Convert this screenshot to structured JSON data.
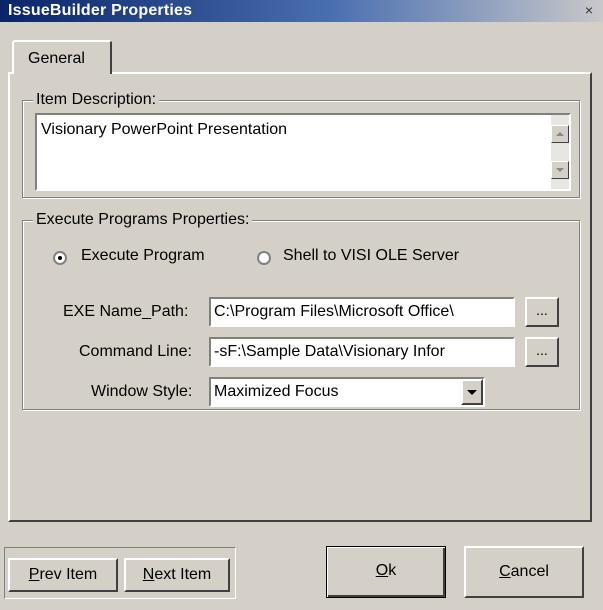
{
  "window": {
    "title": "IssueBuilder Properties",
    "close_glyph": "×"
  },
  "tabs": [
    {
      "label": "General",
      "selected": true
    }
  ],
  "item_description": {
    "legend": "Item Description:",
    "value": "Visionary PowerPoint Presentation"
  },
  "execute": {
    "legend": "Execute Programs Properties:",
    "radio_execute": {
      "label": "Execute Program",
      "checked": true
    },
    "radio_shell": {
      "label": "Shell to VISI OLE Server",
      "checked": false
    },
    "exe_label": "EXE Name_Path:",
    "exe_value": "C:\\Program Files\\Microsoft Office\\",
    "cmd_label": "Command Line:",
    "cmd_value": "-sF:\\Sample Data\\Visionary Infor",
    "browse_label": "...",
    "style_label": "Window Style:",
    "style_value": "Maximized Focus"
  },
  "buttons": {
    "prev_first": "P",
    "prev_rest": "rev Item",
    "next_first": "N",
    "next_rest": "ext Item",
    "ok_first": "O",
    "ok_rest": "k",
    "cancel_first": "C",
    "cancel_rest": "ancel"
  },
  "icons": [
    "close-icon",
    "scroll-up-icon",
    "scroll-down-icon",
    "dropdown-arrow-icon"
  ]
}
